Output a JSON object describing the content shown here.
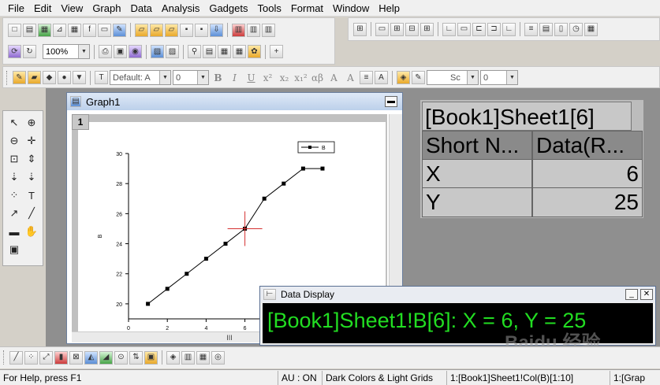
{
  "menubar": {
    "items": [
      "File",
      "Edit",
      "View",
      "Graph",
      "Data",
      "Analysis",
      "Gadgets",
      "Tools",
      "Format",
      "Window",
      "Help"
    ]
  },
  "toolbar": {
    "zoom": "100%",
    "font": "Default: A",
    "font_size": "0",
    "line_style": "Sc",
    "line_width": "0",
    "format_glyphs": [
      "B",
      "I",
      "U",
      "x²",
      "x₂",
      "x₁²",
      "αβ",
      "A",
      "A"
    ]
  },
  "graph_window": {
    "title": "Graph1",
    "layer": "1",
    "scroll_glyph": "III"
  },
  "sheet_panel": {
    "title": "[Book1]Sheet1[6]",
    "headers": [
      "Short N...",
      "Data(R..."
    ],
    "rows": [
      [
        "X",
        "6"
      ],
      [
        "Y",
        "25"
      ]
    ]
  },
  "data_display": {
    "title": "Data Display",
    "text": "[Book1]Sheet1!B[6]:  X = 6, Y = 25"
  },
  "status": {
    "help": "For Help, press F1",
    "au": "AU : ON",
    "theme": "Dark Colors & Light Grids",
    "col": "1:[Book1]Sheet1!Col(B)[1:10]",
    "graph": "1:[Grap"
  },
  "watermark": "Baidu 经验",
  "chart_data": {
    "type": "line",
    "legend": "B",
    "ylabel": "B",
    "xlabel": "",
    "x": [
      1,
      2,
      3,
      4,
      5,
      6,
      7,
      8,
      9,
      10
    ],
    "y": [
      20,
      21,
      22,
      23,
      24,
      25,
      27,
      28,
      29,
      29
    ],
    "xlim": [
      0,
      10
    ],
    "ylim": [
      19,
      30
    ],
    "xticks": [
      "0",
      "2",
      "4",
      "6",
      "8"
    ],
    "yticks": [
      "20",
      "22",
      "24",
      "26",
      "28",
      "30"
    ],
    "marker": {
      "x": 6,
      "y": 25,
      "color": "#d43030"
    }
  }
}
